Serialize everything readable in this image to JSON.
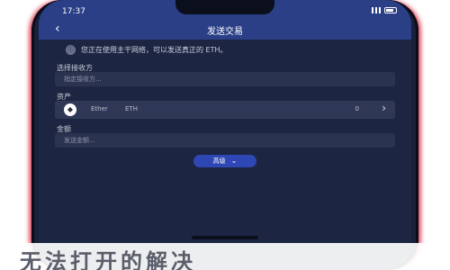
{
  "status_bar": {
    "time": "17:37"
  },
  "nav": {
    "back_icon": "back-arrow-icon",
    "title": "发送交易"
  },
  "notice": {
    "icon": "info-icon",
    "text": "您正在使用主干网络，可以发送真正的 ETH。"
  },
  "recipient": {
    "label": "选择接收方",
    "placeholder": "指定接收方..."
  },
  "asset": {
    "label": "资产",
    "icon": "eth-icon",
    "name": "Ether",
    "code": "ETH",
    "balance": "0",
    "chevron_icon": "chevron-right-icon"
  },
  "amount": {
    "label": "金额",
    "placeholder": "发送金额..."
  },
  "advanced": {
    "label": "高级",
    "chevron_icon": "chevron-down-icon"
  },
  "caption": {
    "text": "无法打开的解决"
  },
  "colors": {
    "header": "#2a3f86",
    "background": "#1c2541",
    "field": "#2a3350",
    "button": "#2e47b4",
    "phone_edge": "#d8223a"
  }
}
